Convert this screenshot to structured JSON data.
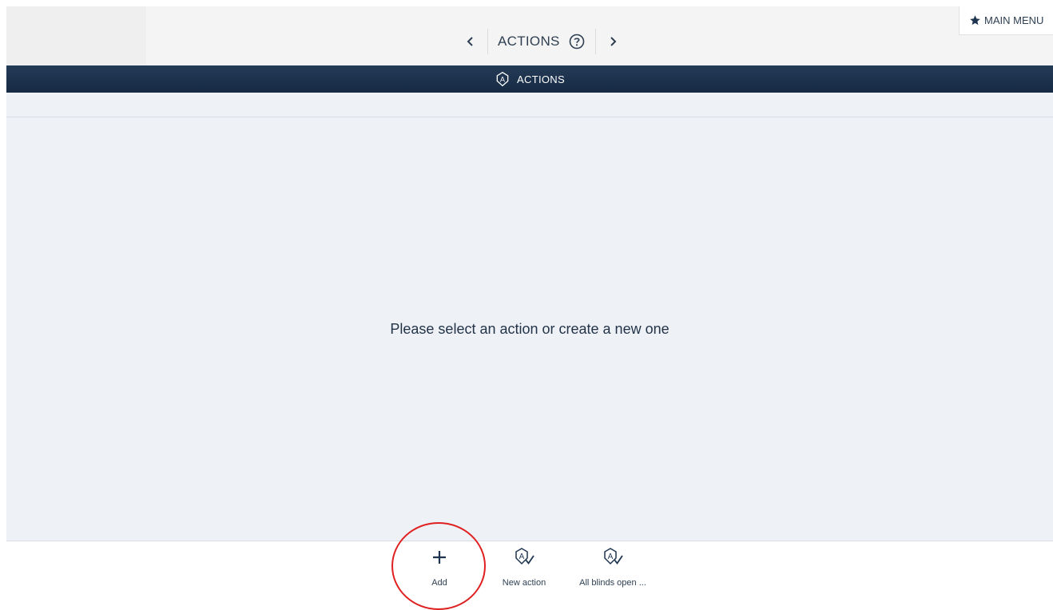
{
  "header": {
    "title": "ACTIONS",
    "main_menu_label": "MAIN MENU"
  },
  "section_bar": {
    "title": "ACTIONS"
  },
  "content": {
    "message": "Please select an action or create a new one"
  },
  "toolbar": {
    "items": [
      {
        "label": "Add",
        "icon": "plus-icon"
      },
      {
        "label": "New action",
        "icon": "action-icon"
      },
      {
        "label": "All blinds open ...",
        "icon": "action-icon"
      }
    ]
  },
  "colors": {
    "navy": "#1e3550",
    "highlight": "#e02020",
    "content_bg": "#eef1f5"
  }
}
